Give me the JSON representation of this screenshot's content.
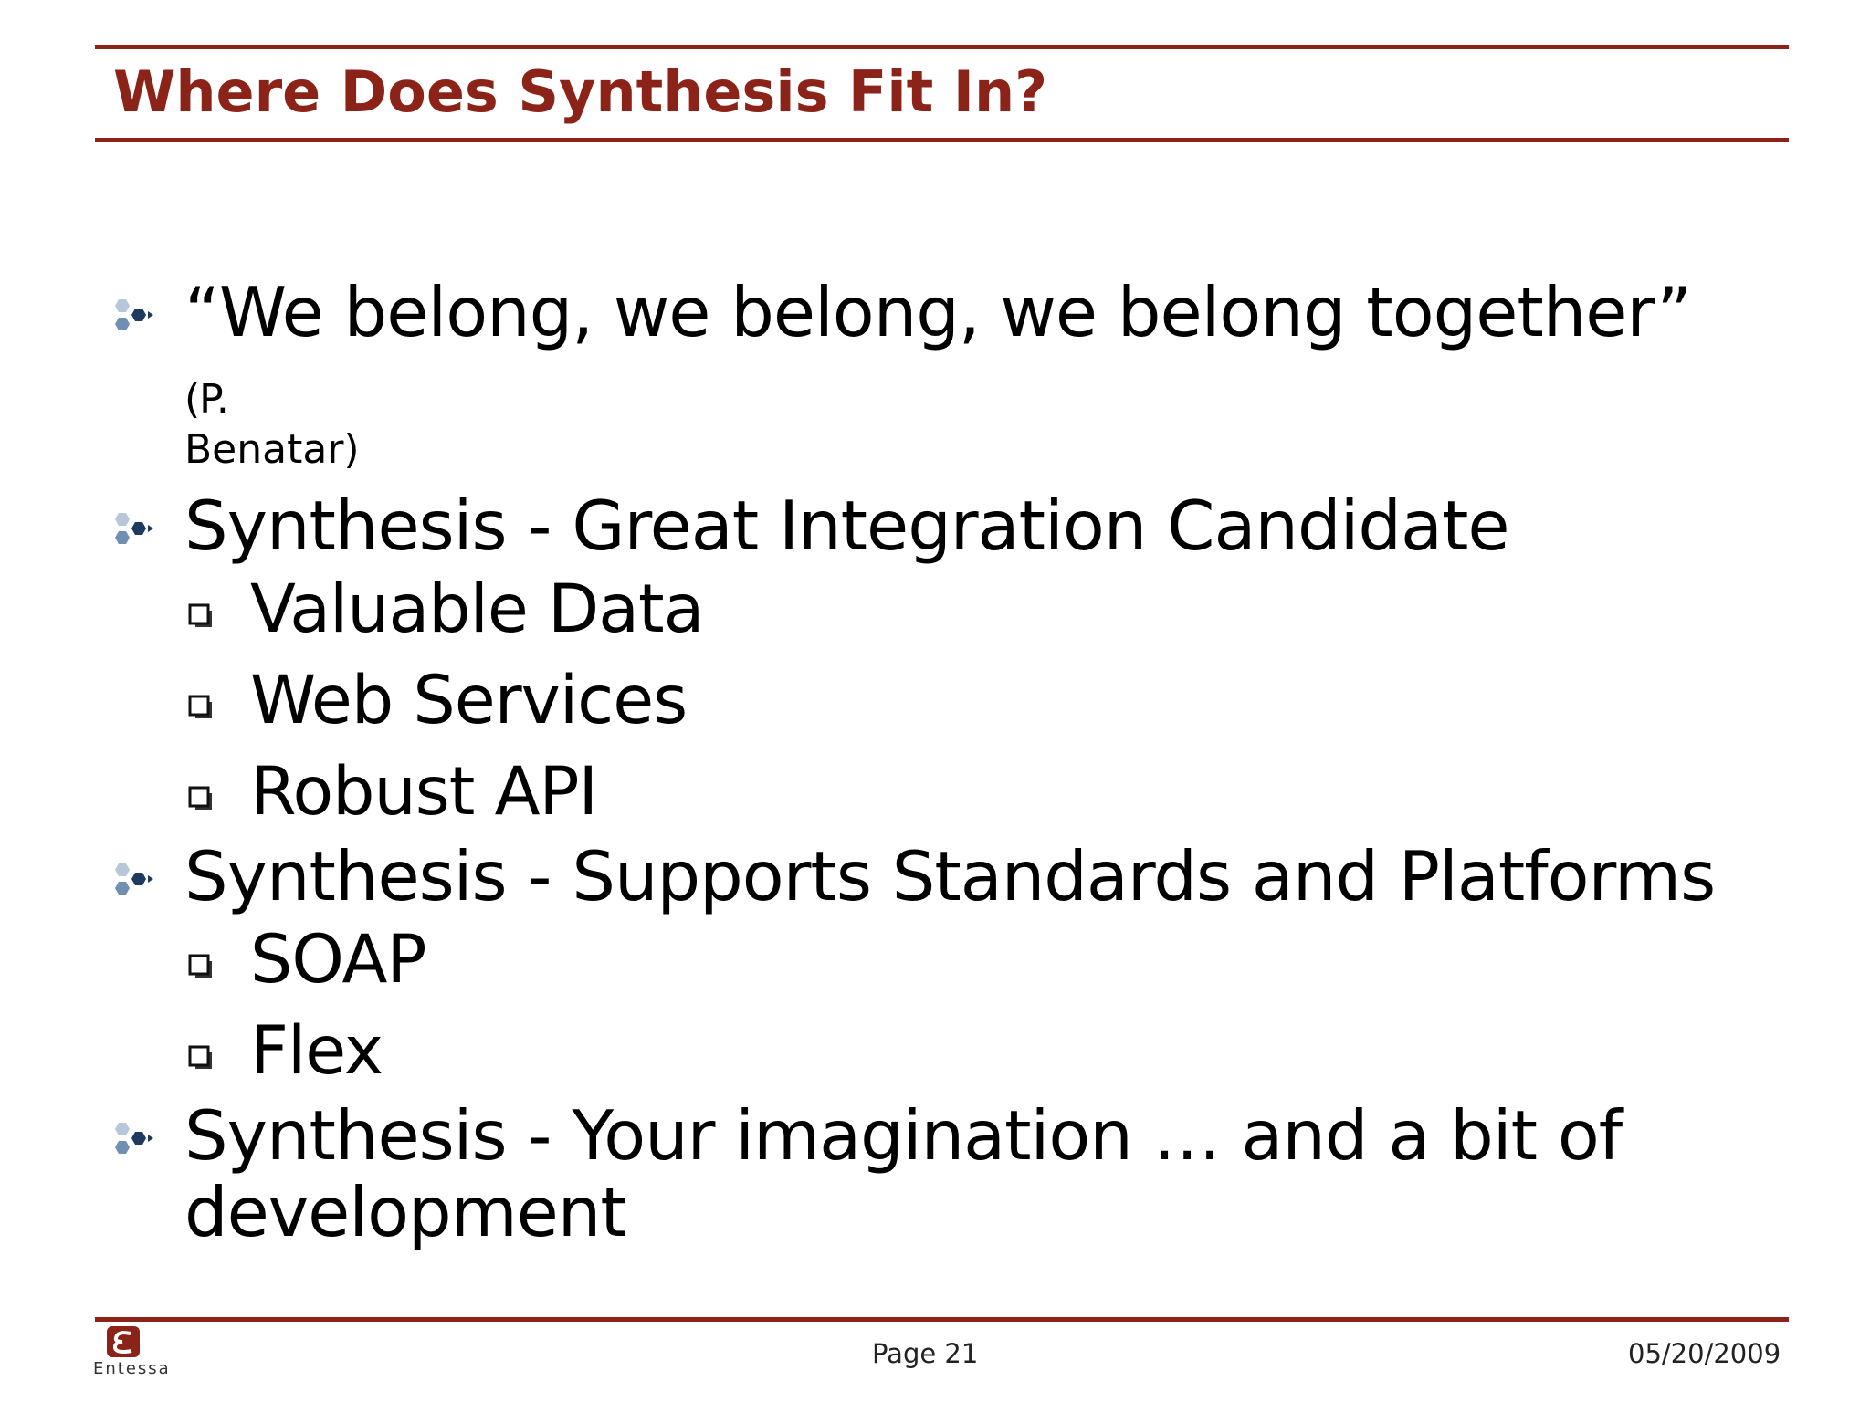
{
  "slide": {
    "title": "Where Does Synthesis Fit In?",
    "accent_color": "#8B2318",
    "bullets": [
      {
        "text": "“We belong, we belong, we belong together”",
        "note_part1": "(P.",
        "note_part2": "Benatar)",
        "icon": "hexagon-cluster-bullet-icon"
      },
      {
        "text": "Synthesis - Great Integration Candidate",
        "icon": "hexagon-cluster-bullet-icon",
        "sub_items": [
          "Valuable Data",
          "Web Services",
          "Robust API"
        ]
      },
      {
        "text": "Synthesis - Supports Standards and Platforms",
        "icon": "hexagon-cluster-bullet-icon",
        "sub_items": [
          "SOAP",
          "Flex"
        ]
      },
      {
        "text_line1": "Synthesis - Your imagination … and a bit of",
        "text_line2": "development",
        "icon": "hexagon-cluster-bullet-icon"
      }
    ]
  },
  "footer": {
    "logo_text": "Entessa",
    "page": "Page 21",
    "date": "05/20/2009"
  }
}
